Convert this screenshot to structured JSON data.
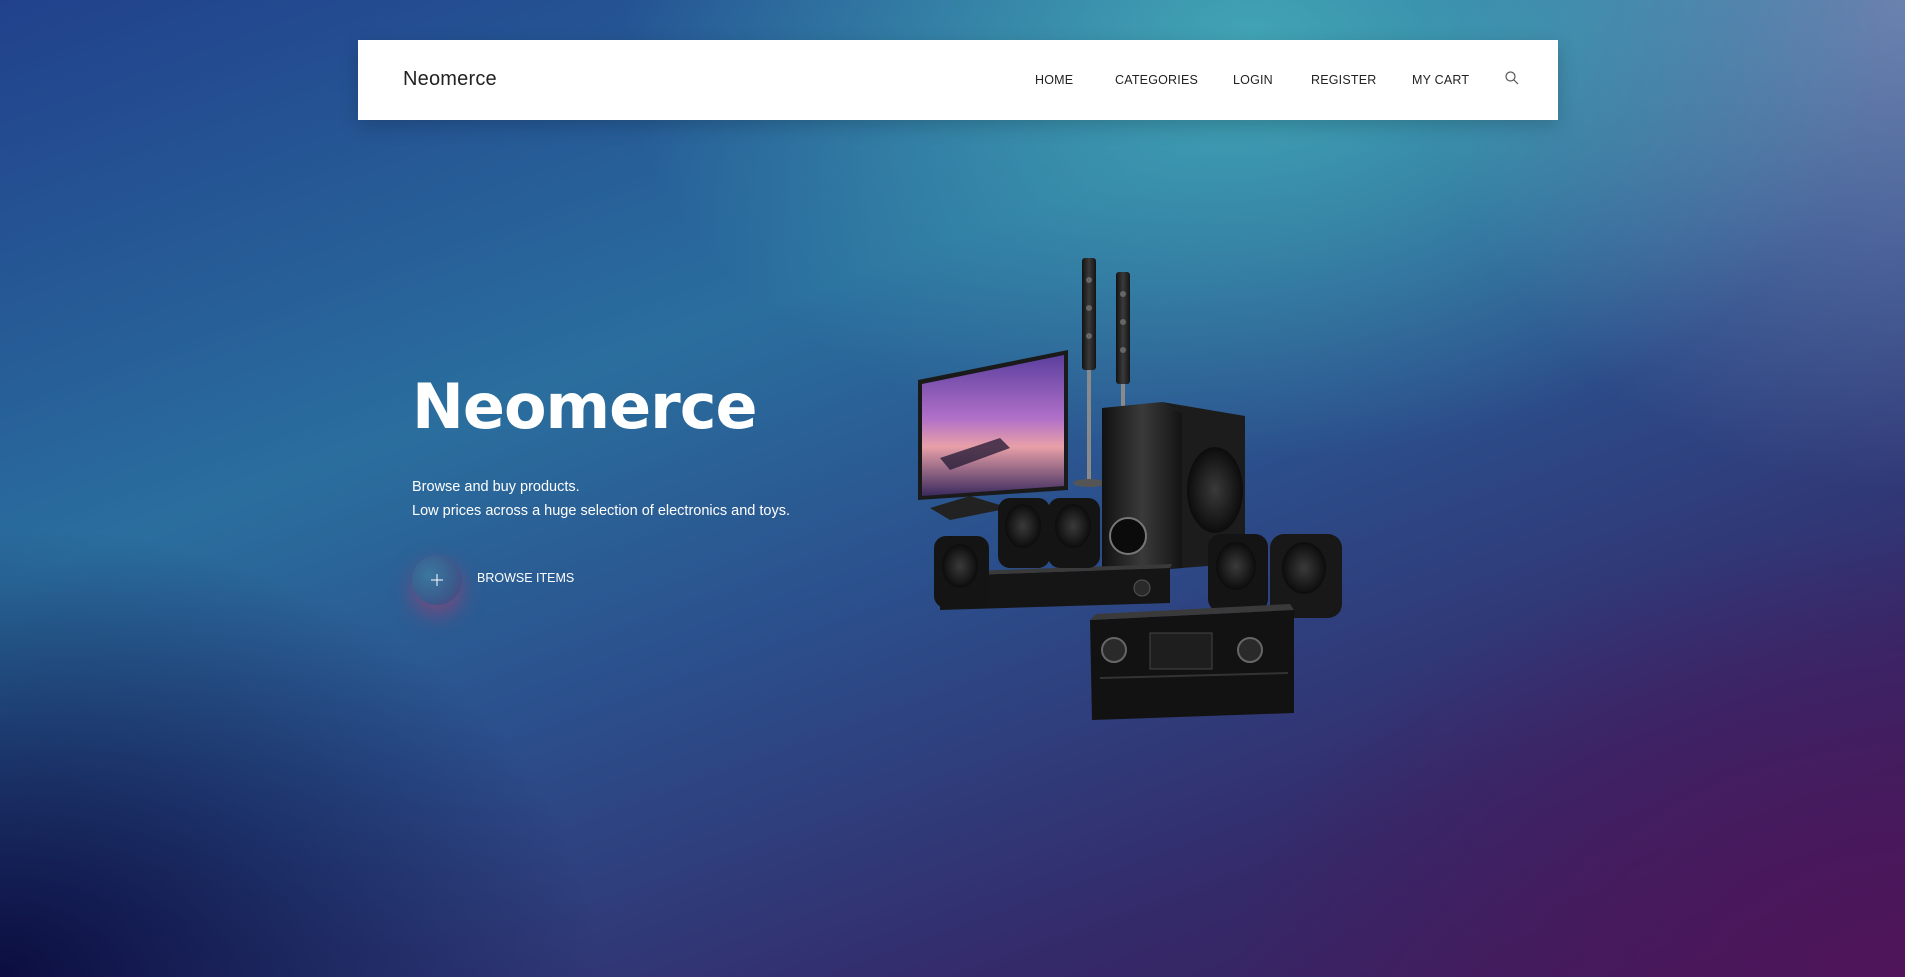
{
  "navbar": {
    "brand": "Neomerce",
    "items": [
      {
        "label": "HOME"
      },
      {
        "label": "CATEGORIES"
      },
      {
        "label": "LOGIN"
      },
      {
        "label": "REGISTER"
      },
      {
        "label": "MY CART"
      }
    ],
    "search_icon": "search-icon"
  },
  "hero": {
    "title": "Neomerce",
    "line1": "Browse and buy products.",
    "line2": "Low prices across a huge selection of electronics and toys.",
    "button_label": "BROWSE ITEMS",
    "button_icon": "plus-icon",
    "image": "home-theater-electronics"
  },
  "colors": {
    "navbar_bg": "#ffffff",
    "text_dark": "#222222",
    "text_light": "#ffffff",
    "button_glow": "#b43c6e"
  }
}
